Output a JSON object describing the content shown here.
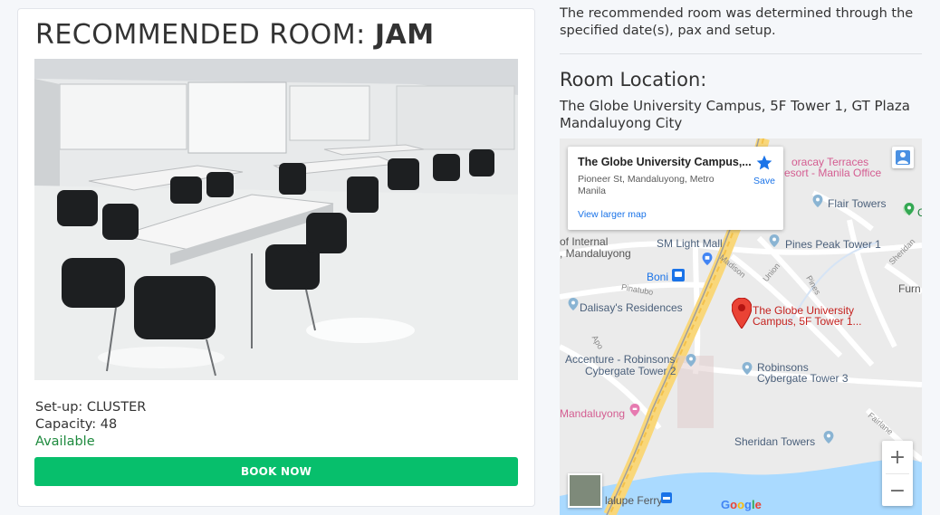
{
  "card": {
    "title_prefix": "RECOMMENDED ROOM:",
    "room_name": "JAM",
    "setup_label": "Set-up: CLUSTER",
    "capacity_label": "Capacity: 48",
    "status": "Available",
    "book_button": "BOOK NOW"
  },
  "side": {
    "note": "The recommended room was determined through the specified date(s), pax and setup.",
    "location_title": "Room Location:",
    "address": "The Globe University Campus, 5F Tower 1, GT Plaza Mandaluyong City"
  },
  "map": {
    "info_window": {
      "title": "The Globe University Campus,...",
      "address": "Pioneer St, Mandaluyong, Metro Manila",
      "larger_map_link": "View larger map",
      "save_label": "Save"
    },
    "labels": {
      "boracay": "oracay Terraces",
      "resort": "esort - Manila Office",
      "flair": "Flair Towers",
      "pines_peak": "Pines Peak Tower 1",
      "sm_light": "SM Light Mall",
      "internal": "of Internal",
      "mandaluyong_a": ", Mandaluyong",
      "boni": "Boni",
      "dalisay": "Dalisay's Residences",
      "globe_pin_line1": "The Globe University",
      "globe_pin_line2": "Campus, 5F Tower 1...",
      "accenture_line1": "Accenture - Robinsons",
      "accenture_line2": "Cybergate Tower 2",
      "robinsons_line1": "Robinsons",
      "robinsons_line2": "Cybergate Tower 3",
      "mandaluyong_b": "Mandaluyong",
      "sheridan": "Sheridan Towers",
      "ferry": "lalupe Ferry",
      "furn": "Furn",
      "g_edge": "G",
      "madison": "Madison",
      "union": "Union",
      "pines_st": "Pines",
      "sheridan_st": "Sheridan",
      "pinatubo": "Pinatubo",
      "apo": "Apo",
      "fairlane": "Fairlane",
      "google": "Google"
    },
    "zoom_in": "+",
    "zoom_out": "−"
  },
  "colors": {
    "book_button": "#07bf6c",
    "available_text": "#1e8a3e",
    "link_blue": "#1a73e8",
    "map_pin_red": "#ea4335"
  },
  "icons": [
    "star-icon",
    "pegman-icon",
    "map-pin-icon",
    "transit-icon",
    "shopping-icon",
    "hotel-icon",
    "ferry-icon",
    "plus-icon",
    "minus-icon"
  ]
}
